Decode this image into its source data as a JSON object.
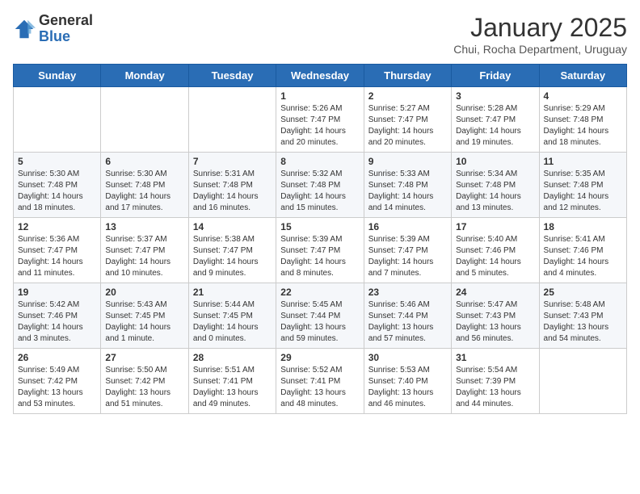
{
  "logo": {
    "general": "General",
    "blue": "Blue"
  },
  "header": {
    "month": "January 2025",
    "location": "Chui, Rocha Department, Uruguay"
  },
  "days_of_week": [
    "Sunday",
    "Monday",
    "Tuesday",
    "Wednesday",
    "Thursday",
    "Friday",
    "Saturday"
  ],
  "weeks": [
    [
      {
        "day": "",
        "info": ""
      },
      {
        "day": "",
        "info": ""
      },
      {
        "day": "",
        "info": ""
      },
      {
        "day": "1",
        "info": "Sunrise: 5:26 AM\nSunset: 7:47 PM\nDaylight: 14 hours\nand 20 minutes."
      },
      {
        "day": "2",
        "info": "Sunrise: 5:27 AM\nSunset: 7:47 PM\nDaylight: 14 hours\nand 20 minutes."
      },
      {
        "day": "3",
        "info": "Sunrise: 5:28 AM\nSunset: 7:47 PM\nDaylight: 14 hours\nand 19 minutes."
      },
      {
        "day": "4",
        "info": "Sunrise: 5:29 AM\nSunset: 7:48 PM\nDaylight: 14 hours\nand 18 minutes."
      }
    ],
    [
      {
        "day": "5",
        "info": "Sunrise: 5:30 AM\nSunset: 7:48 PM\nDaylight: 14 hours\nand 18 minutes."
      },
      {
        "day": "6",
        "info": "Sunrise: 5:30 AM\nSunset: 7:48 PM\nDaylight: 14 hours\nand 17 minutes."
      },
      {
        "day": "7",
        "info": "Sunrise: 5:31 AM\nSunset: 7:48 PM\nDaylight: 14 hours\nand 16 minutes."
      },
      {
        "day": "8",
        "info": "Sunrise: 5:32 AM\nSunset: 7:48 PM\nDaylight: 14 hours\nand 15 minutes."
      },
      {
        "day": "9",
        "info": "Sunrise: 5:33 AM\nSunset: 7:48 PM\nDaylight: 14 hours\nand 14 minutes."
      },
      {
        "day": "10",
        "info": "Sunrise: 5:34 AM\nSunset: 7:48 PM\nDaylight: 14 hours\nand 13 minutes."
      },
      {
        "day": "11",
        "info": "Sunrise: 5:35 AM\nSunset: 7:48 PM\nDaylight: 14 hours\nand 12 minutes."
      }
    ],
    [
      {
        "day": "12",
        "info": "Sunrise: 5:36 AM\nSunset: 7:47 PM\nDaylight: 14 hours\nand 11 minutes."
      },
      {
        "day": "13",
        "info": "Sunrise: 5:37 AM\nSunset: 7:47 PM\nDaylight: 14 hours\nand 10 minutes."
      },
      {
        "day": "14",
        "info": "Sunrise: 5:38 AM\nSunset: 7:47 PM\nDaylight: 14 hours\nand 9 minutes."
      },
      {
        "day": "15",
        "info": "Sunrise: 5:39 AM\nSunset: 7:47 PM\nDaylight: 14 hours\nand 8 minutes."
      },
      {
        "day": "16",
        "info": "Sunrise: 5:39 AM\nSunset: 7:47 PM\nDaylight: 14 hours\nand 7 minutes."
      },
      {
        "day": "17",
        "info": "Sunrise: 5:40 AM\nSunset: 7:46 PM\nDaylight: 14 hours\nand 5 minutes."
      },
      {
        "day": "18",
        "info": "Sunrise: 5:41 AM\nSunset: 7:46 PM\nDaylight: 14 hours\nand 4 minutes."
      }
    ],
    [
      {
        "day": "19",
        "info": "Sunrise: 5:42 AM\nSunset: 7:46 PM\nDaylight: 14 hours\nand 3 minutes."
      },
      {
        "day": "20",
        "info": "Sunrise: 5:43 AM\nSunset: 7:45 PM\nDaylight: 14 hours\nand 1 minute."
      },
      {
        "day": "21",
        "info": "Sunrise: 5:44 AM\nSunset: 7:45 PM\nDaylight: 14 hours\nand 0 minutes."
      },
      {
        "day": "22",
        "info": "Sunrise: 5:45 AM\nSunset: 7:44 PM\nDaylight: 13 hours\nand 59 minutes."
      },
      {
        "day": "23",
        "info": "Sunrise: 5:46 AM\nSunset: 7:44 PM\nDaylight: 13 hours\nand 57 minutes."
      },
      {
        "day": "24",
        "info": "Sunrise: 5:47 AM\nSunset: 7:43 PM\nDaylight: 13 hours\nand 56 minutes."
      },
      {
        "day": "25",
        "info": "Sunrise: 5:48 AM\nSunset: 7:43 PM\nDaylight: 13 hours\nand 54 minutes."
      }
    ],
    [
      {
        "day": "26",
        "info": "Sunrise: 5:49 AM\nSunset: 7:42 PM\nDaylight: 13 hours\nand 53 minutes."
      },
      {
        "day": "27",
        "info": "Sunrise: 5:50 AM\nSunset: 7:42 PM\nDaylight: 13 hours\nand 51 minutes."
      },
      {
        "day": "28",
        "info": "Sunrise: 5:51 AM\nSunset: 7:41 PM\nDaylight: 13 hours\nand 49 minutes."
      },
      {
        "day": "29",
        "info": "Sunrise: 5:52 AM\nSunset: 7:41 PM\nDaylight: 13 hours\nand 48 minutes."
      },
      {
        "day": "30",
        "info": "Sunrise: 5:53 AM\nSunset: 7:40 PM\nDaylight: 13 hours\nand 46 minutes."
      },
      {
        "day": "31",
        "info": "Sunrise: 5:54 AM\nSunset: 7:39 PM\nDaylight: 13 hours\nand 44 minutes."
      },
      {
        "day": "",
        "info": ""
      }
    ]
  ]
}
